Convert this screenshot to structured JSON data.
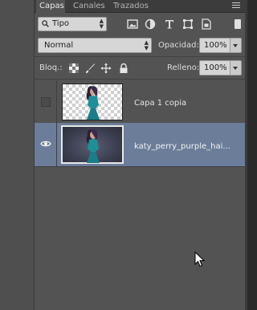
{
  "panel": {
    "tabs": [
      {
        "label": "Capas",
        "active": true
      },
      {
        "label": "Canales",
        "active": false
      },
      {
        "label": "Trazados",
        "active": false
      }
    ],
    "menu_icon": "panel-menu-icon"
  },
  "filter": {
    "kind_label": "Tipo",
    "icons": [
      "image-filter-icon",
      "adjustment-filter-icon",
      "type-filter-icon",
      "shape-filter-icon",
      "smart-object-filter-icon"
    ],
    "type_glyph": "T"
  },
  "blend": {
    "mode": "Normal",
    "opacity_label": "Opacidad:",
    "opacity_value": "100%"
  },
  "lock": {
    "label": "Bloq.:",
    "icons": [
      "lock-transparency-icon",
      "lock-pixels-icon",
      "lock-position-icon",
      "lock-all-icon"
    ],
    "fill_label": "Relleno:",
    "fill_value": "100%"
  },
  "layers": [
    {
      "name": "Capa 1 copia",
      "visible": false,
      "selected": false,
      "thumbnail": "transparent-checker"
    },
    {
      "name": "katy_perry_purple_hai...",
      "visible": true,
      "selected": true,
      "thumbnail": "photo"
    }
  ],
  "colors": {
    "panel_bg": "#535353",
    "selected_layer": "#6b7d99",
    "tab_bar": "#3c3c3c"
  }
}
